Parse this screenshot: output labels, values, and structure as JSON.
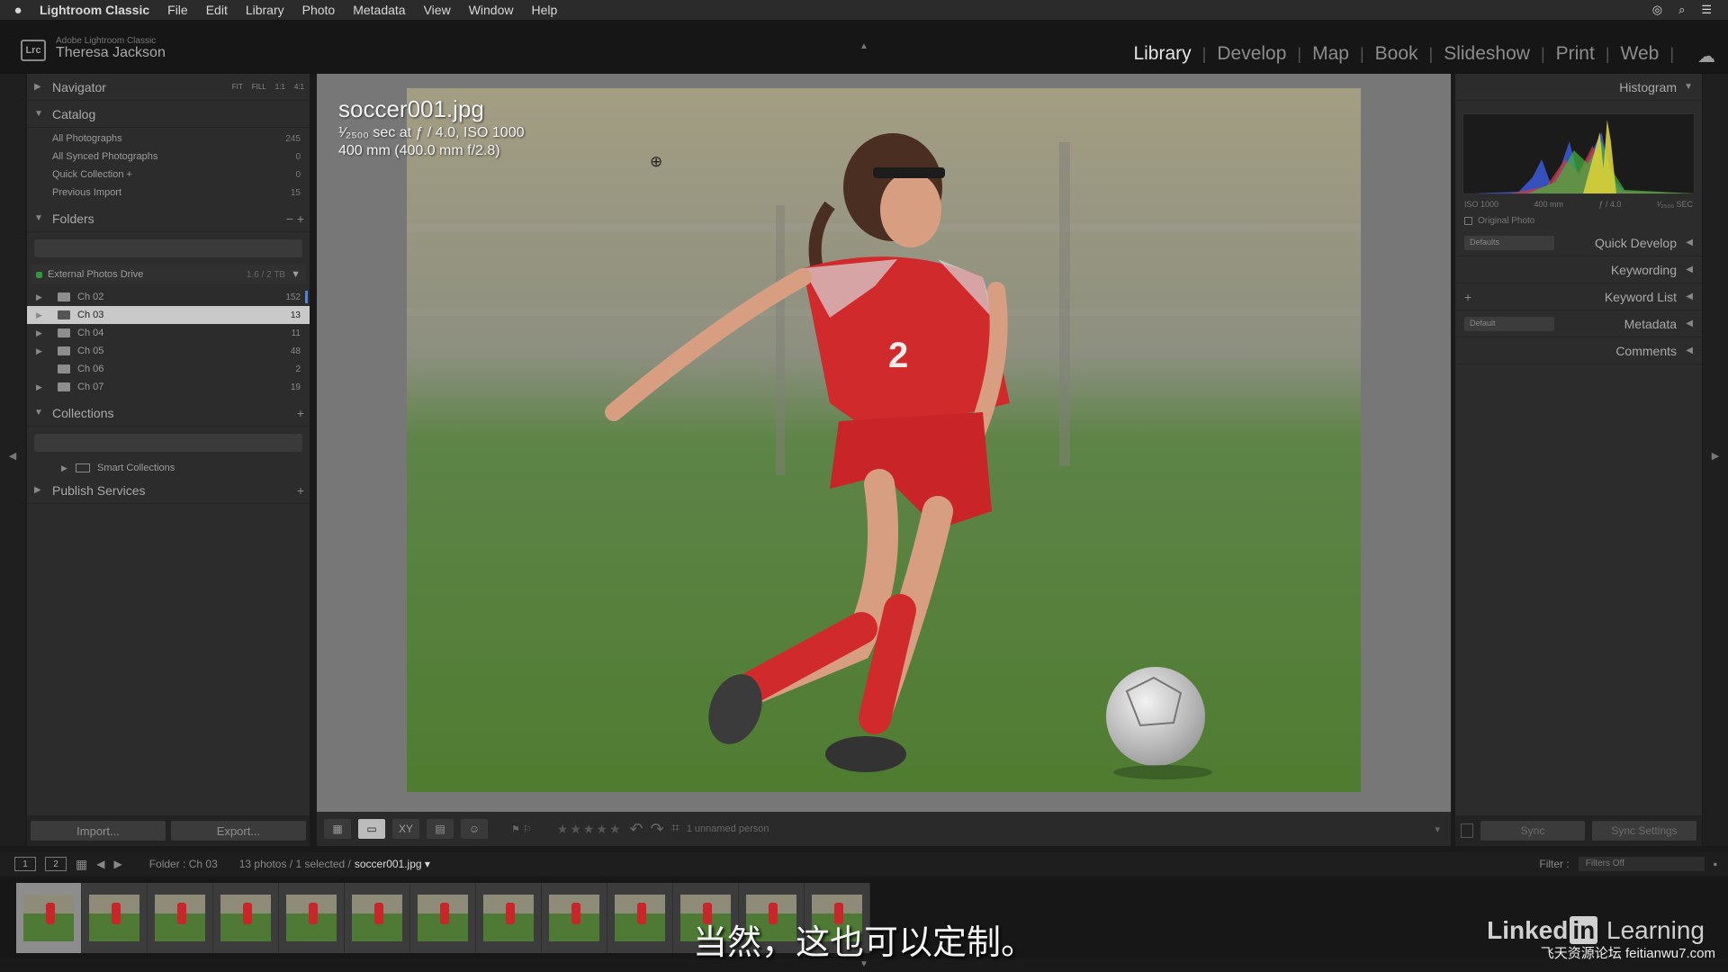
{
  "menubar": {
    "app_name": "Lightroom Classic",
    "items": [
      "File",
      "Edit",
      "Library",
      "Photo",
      "Metadata",
      "View",
      "Window",
      "Help"
    ]
  },
  "identity": {
    "logo": "Lrc",
    "product": "Adobe Lightroom Classic",
    "user": "Theresa Jackson"
  },
  "modules": [
    "Library",
    "Develop",
    "Map",
    "Book",
    "Slideshow",
    "Print",
    "Web"
  ],
  "active_module": "Library",
  "left_panel": {
    "navigator": {
      "title": "Navigator",
      "options": [
        "FIT",
        "FILL",
        "1:1",
        "4:1"
      ]
    },
    "catalog": {
      "title": "Catalog",
      "rows": [
        {
          "label": "All Photographs",
          "count": "245"
        },
        {
          "label": "All Synced Photographs",
          "count": "0"
        },
        {
          "label": "Quick Collection +",
          "count": "0"
        },
        {
          "label": "Previous Import",
          "count": "15"
        }
      ]
    },
    "folders": {
      "title": "Folders",
      "drive": {
        "label": "External Photos Drive",
        "count": "1.6 / 2 TB"
      },
      "rows": [
        {
          "label": "Ch 02",
          "count": "152"
        },
        {
          "label": "Ch 03",
          "count": "13"
        },
        {
          "label": "Ch 04",
          "count": "11"
        },
        {
          "label": "Ch 05",
          "count": "48"
        },
        {
          "label": "Ch 06",
          "count": "2"
        },
        {
          "label": "Ch 07",
          "count": "19"
        }
      ]
    },
    "collections": {
      "title": "Collections",
      "smart": "Smart Collections"
    },
    "publish": {
      "title": "Publish Services"
    },
    "import_label": "Import...",
    "export_label": "Export..."
  },
  "photo_info": {
    "filename": "soccer001.jpg",
    "exposure": "¹⁄₂₅₀₀ sec at ƒ / 4.0, ISO 1000",
    "lens": "400 mm (400.0 mm f/2.8)"
  },
  "toolbar": {
    "person": "1 unnamed person"
  },
  "right_panel": {
    "histogram": {
      "title": "Histogram",
      "labels": [
        "ISO 1000",
        "400 mm",
        "ƒ / 4.0",
        "¹⁄₂₅₀₀ SEC"
      ],
      "original": "Original Photo"
    },
    "quick_develop": {
      "title": "Quick Develop",
      "preset": "Defaults"
    },
    "keywording": "Keywording",
    "keyword_list": "Keyword List",
    "metadata": {
      "title": "Metadata",
      "preset": "Default"
    },
    "comments": "Comments",
    "sync_label": "Sync",
    "sync_settings_label": "Sync Settings"
  },
  "filmstrip_bar": {
    "screen1": "1",
    "screen2": "2",
    "folder": "Folder : Ch 03",
    "count": "13 photos / 1 selected /",
    "selected_file": "soccer001.jpg ▾",
    "filter_label": "Filter :",
    "filter_value": "Filters Off"
  },
  "filmstrip": {
    "thumb_count": 13,
    "selected_index": 0
  },
  "subtitle": "当然，这也可以定制。",
  "watermark": {
    "pre": "Linked",
    "in": "in",
    "post": " Learning"
  },
  "site": "飞天资源论坛 feitianwu7.com",
  "colors": {
    "folder_selection_bar": "#4a86d6",
    "drive_indicator": "#2f9a3a",
    "jersey_red": "#d02a2c"
  }
}
